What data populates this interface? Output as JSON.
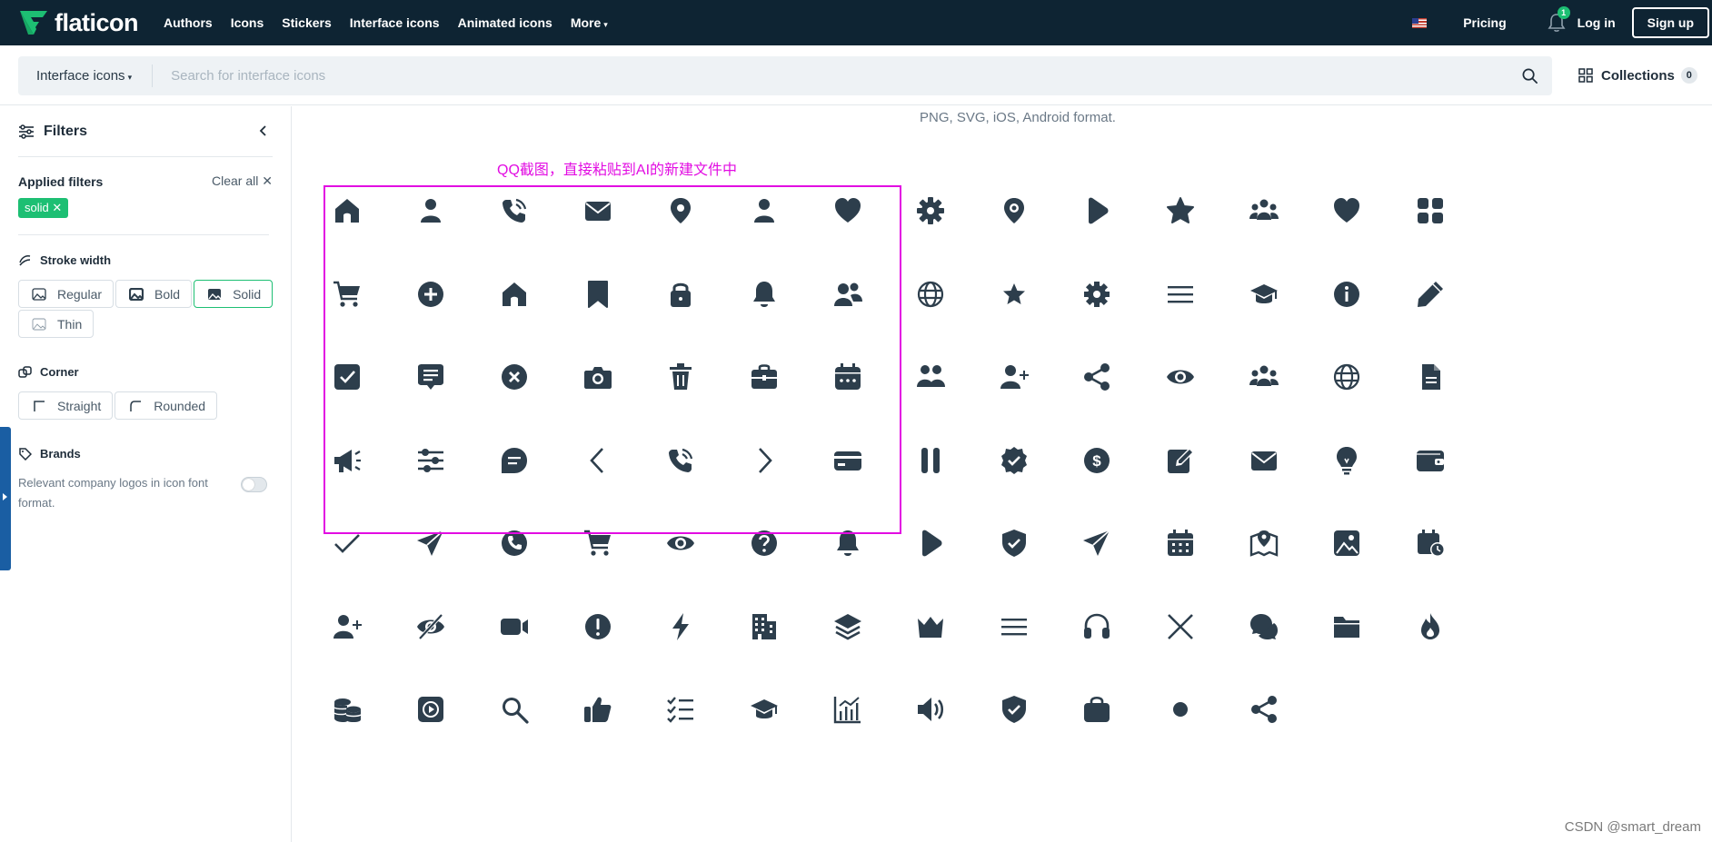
{
  "brand": {
    "name": "flaticon"
  },
  "nav": {
    "items": [
      {
        "label": "Authors"
      },
      {
        "label": "Icons"
      },
      {
        "label": "Stickers"
      },
      {
        "label": "Interface icons"
      },
      {
        "label": "Animated icons"
      },
      {
        "label": "More"
      }
    ]
  },
  "header_right": {
    "pricing": "Pricing",
    "notification_count": "1",
    "login": "Log in",
    "signup": "Sign up"
  },
  "search": {
    "type_label": "Interface icons",
    "placeholder": "Search for interface icons",
    "value": ""
  },
  "collections": {
    "label": "Collections",
    "count": "0"
  },
  "sidebar": {
    "title": "Filters",
    "applied_title": "Applied filters",
    "clear_all": "Clear all",
    "chip": "solid",
    "stroke_title": "Stroke width",
    "stroke_options": [
      {
        "label": "Regular",
        "active": false
      },
      {
        "label": "Bold",
        "active": false
      },
      {
        "label": "Solid",
        "active": true
      },
      {
        "label": "Thin",
        "active": false
      }
    ],
    "corner_title": "Corner",
    "corner_options": [
      {
        "label": "Straight"
      },
      {
        "label": "Rounded"
      }
    ],
    "brands_title": "Brands",
    "brands_text": "Relevant company logos in icon font format.",
    "brands_toggle_on": false
  },
  "main": {
    "formats_text": "PNG, SVG, iOS, Android format.",
    "annotation": "QQ截图，直接粘贴到AI的新建文件中",
    "icon_color": "#2d3e4c",
    "icons": [
      [
        "home",
        "user",
        "phone-call",
        "envelope",
        "marker",
        "user",
        "heart",
        "settings",
        "location",
        "play",
        "star",
        "users",
        "heart",
        "apps"
      ],
      [
        "shopping-cart",
        "add",
        "home",
        "bookmark",
        "lock",
        "bell",
        "user-group",
        "globe",
        "star-small",
        "gear",
        "menu-burger",
        "graduation-cap",
        "info",
        "pencil"
      ],
      [
        "checkbox",
        "comment-alt",
        "cross-circle",
        "camera",
        "trash",
        "briefcase",
        "calendar-dots",
        "users-alt",
        "user-add",
        "share",
        "eye",
        "users",
        "globe",
        "document"
      ],
      [
        "megaphone",
        "settings-sliders",
        "comment",
        "angle-left",
        "phone-call",
        "angle-right",
        "credit-card",
        "pause",
        "badge-check",
        "dollar",
        "edit",
        "envelope",
        "bulb",
        "wallet"
      ],
      [
        "check",
        "paper-plane",
        "phone",
        "shopping-cart",
        "eye",
        "question",
        "bell",
        "play",
        "shield-check",
        "paper-plane",
        "calendar",
        "map-marker",
        "picture",
        "calendar-clock"
      ],
      [
        "user-add",
        "eye-crossed",
        "video-camera",
        "exclamation",
        "bolt",
        "building",
        "layers",
        "crown",
        "menu-burger",
        "headset",
        "cross",
        "comments",
        "folder",
        "flame"
      ],
      [
        "coins",
        "play-alt",
        "search",
        "thumbs-up",
        "list-check",
        "graduation-cap",
        "stats",
        "volume",
        "shield-check",
        "shopping-bag",
        "circle",
        "share"
      ]
    ],
    "colors": {
      "accent": "#1dbf73",
      "navbar": "#0e2433",
      "annotation": "#e20ce2"
    }
  },
  "watermark": "CSDN @smart_dream"
}
